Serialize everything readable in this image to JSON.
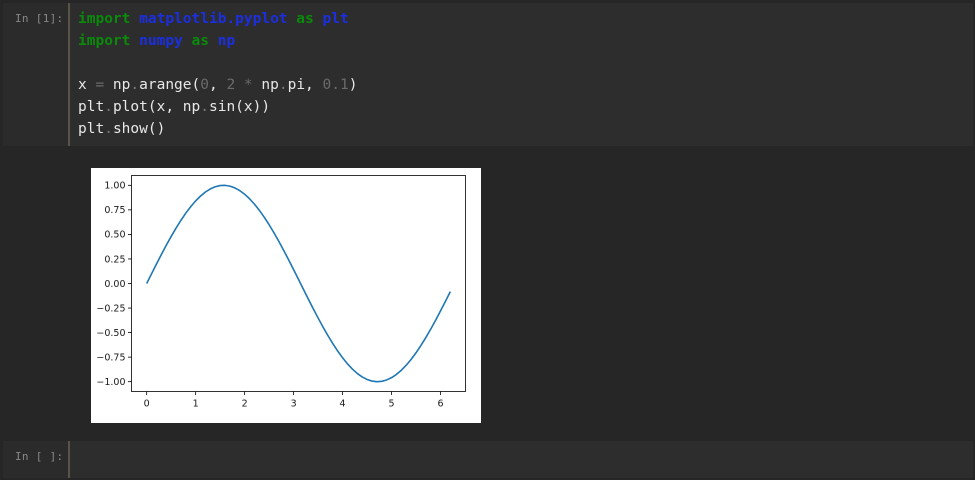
{
  "cells": [
    {
      "prompt": "In [1]:",
      "code_lines": [
        [
          {
            "t": "import",
            "c": "kw"
          },
          {
            "t": " "
          },
          {
            "t": "matplotlib.pyplot",
            "c": "mod"
          },
          {
            "t": " "
          },
          {
            "t": "as",
            "c": "kw"
          },
          {
            "t": " "
          },
          {
            "t": "plt",
            "c": "mod"
          }
        ],
        [
          {
            "t": "import",
            "c": "kw"
          },
          {
            "t": " "
          },
          {
            "t": "numpy",
            "c": "mod"
          },
          {
            "t": " "
          },
          {
            "t": "as",
            "c": "kw"
          },
          {
            "t": " "
          },
          {
            "t": "np",
            "c": "mod"
          }
        ],
        [],
        [
          {
            "t": "x "
          },
          {
            "t": "=",
            "c": "op"
          },
          {
            "t": " np"
          },
          {
            "t": ".",
            "c": "dot"
          },
          {
            "t": "arange("
          },
          {
            "t": "0",
            "c": "num"
          },
          {
            "t": ", "
          },
          {
            "t": "2",
            "c": "num"
          },
          {
            "t": " "
          },
          {
            "t": "*",
            "c": "op"
          },
          {
            "t": " np"
          },
          {
            "t": ".",
            "c": "dot"
          },
          {
            "t": "pi, "
          },
          {
            "t": "0.1",
            "c": "num"
          },
          {
            "t": ")"
          }
        ],
        [
          {
            "t": "plt"
          },
          {
            "t": ".",
            "c": "dot"
          },
          {
            "t": "plot(x, np"
          },
          {
            "t": ".",
            "c": "dot"
          },
          {
            "t": "sin(x))"
          }
        ],
        [
          {
            "t": "plt"
          },
          {
            "t": ".",
            "c": "dot"
          },
          {
            "t": "show()"
          }
        ]
      ]
    },
    {
      "prompt": "In [ ]:",
      "code_lines": []
    }
  ],
  "chart_data": {
    "type": "line",
    "title": "",
    "xlabel": "",
    "ylabel": "",
    "xlim": [
      -0.31,
      6.51
    ],
    "ylim": [
      -1.1,
      1.1
    ],
    "xticks": [
      0,
      1,
      2,
      3,
      4,
      5,
      6
    ],
    "yticks": [
      1.0,
      0.75,
      0.5,
      0.25,
      0.0,
      -0.25,
      -0.5,
      -0.75,
      -1.0
    ],
    "ytick_labels": [
      "1.00",
      "0.75",
      "0.50",
      "0.25",
      "0.00",
      "−0.25",
      "−0.50",
      "−0.75",
      "−1.00"
    ],
    "xtick_labels": [
      "0",
      "1",
      "2",
      "3",
      "4",
      "5",
      "6"
    ],
    "grid": false,
    "series": [
      {
        "color": "#1f77b4",
        "x": [
          0.0,
          0.1,
          0.2,
          0.3,
          0.4,
          0.5,
          0.6,
          0.7,
          0.8,
          0.9,
          1.0,
          1.1,
          1.2,
          1.3,
          1.4,
          1.5,
          1.6,
          1.7,
          1.8,
          1.9,
          2.0,
          2.1,
          2.2,
          2.3,
          2.4,
          2.5,
          2.6,
          2.7,
          2.8,
          2.9,
          3.0,
          3.1,
          3.2,
          3.3,
          3.4,
          3.5,
          3.6,
          3.7,
          3.8,
          3.9,
          4.0,
          4.1,
          4.2,
          4.3,
          4.4,
          4.5,
          4.6,
          4.7,
          4.8,
          4.9,
          5.0,
          5.1,
          5.2,
          5.3,
          5.4,
          5.5,
          5.6,
          5.7,
          5.8,
          5.9,
          6.0,
          6.1,
          6.2
        ],
        "y": [
          0.0,
          0.0998,
          0.1987,
          0.2955,
          0.3894,
          0.4794,
          0.5646,
          0.6442,
          0.7174,
          0.7833,
          0.8415,
          0.8912,
          0.932,
          0.9636,
          0.9854,
          0.9975,
          0.9996,
          0.9917,
          0.9738,
          0.9463,
          0.9093,
          0.8632,
          0.8085,
          0.7457,
          0.6755,
          0.5985,
          0.5155,
          0.4274,
          0.335,
          0.2392,
          0.1411,
          0.0416,
          -0.0584,
          -0.1577,
          -0.2555,
          -0.3508,
          -0.4425,
          -0.5298,
          -0.6119,
          -0.6878,
          -0.7568,
          -0.8183,
          -0.8716,
          -0.9162,
          -0.9516,
          -0.9775,
          -0.9937,
          -0.9999,
          -0.9962,
          -0.9825,
          -0.9589,
          -0.9258,
          -0.8835,
          -0.8323,
          -0.7728,
          -0.7055,
          -0.6313,
          -0.5507,
          -0.4646,
          -0.3739,
          -0.2794,
          -0.1822,
          -0.0831
        ]
      }
    ]
  },
  "colors": {
    "background": "#262626",
    "cell_background": "#2d2d2d",
    "keyword": "#0a8a0a",
    "module": "#1b2ee0",
    "number": "#6a6a6a",
    "line": "#1f77b4"
  }
}
